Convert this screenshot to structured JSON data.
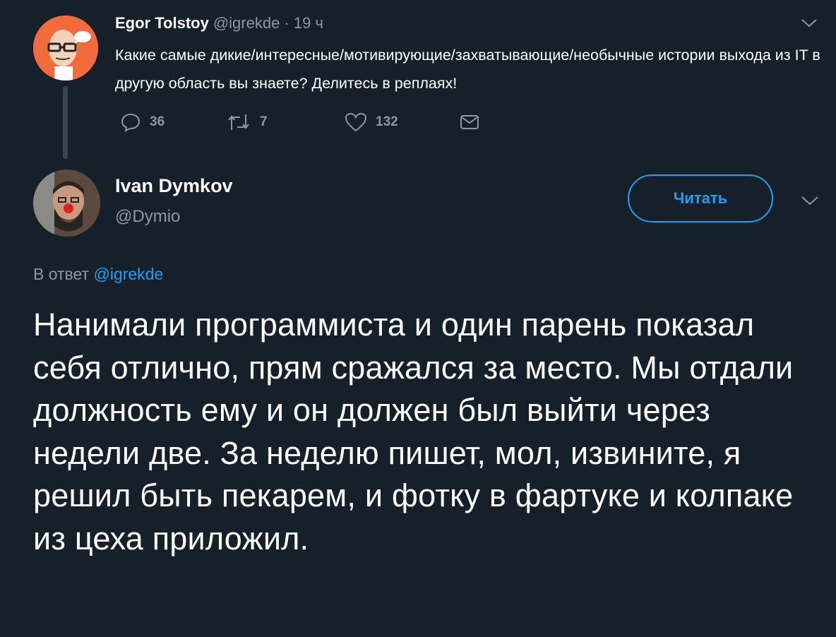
{
  "parent": {
    "name": "Egor Tolstoy",
    "meta": "@igrekde · 19 ч",
    "text": "Какие самые дикие/интересные/мотивирующие/захватывающие/необычные истории выхода из IT в другую область вы знаете? Делитесь в реплаях!",
    "actions": {
      "replies": "36",
      "retweets": "7",
      "likes": "132"
    }
  },
  "reply": {
    "name": "Ivan Dymkov",
    "handle": "@Dymio",
    "follow_label": "Читать",
    "reply_to_prefix": "В ответ",
    "reply_to_handle": "@igrekde",
    "body": "Нанимали программиста и один парень показал себя отлично, прям сражался за место. Мы отдали должность ему и он должен был выйти через недели две. За неделю пишет, мол, извините, я решил быть пекарем, и фотку в фартуке и колпаке из цеха приложил."
  },
  "colors": {
    "background": "#15202b",
    "accent": "#1da1f2",
    "muted": "#8899a6"
  }
}
